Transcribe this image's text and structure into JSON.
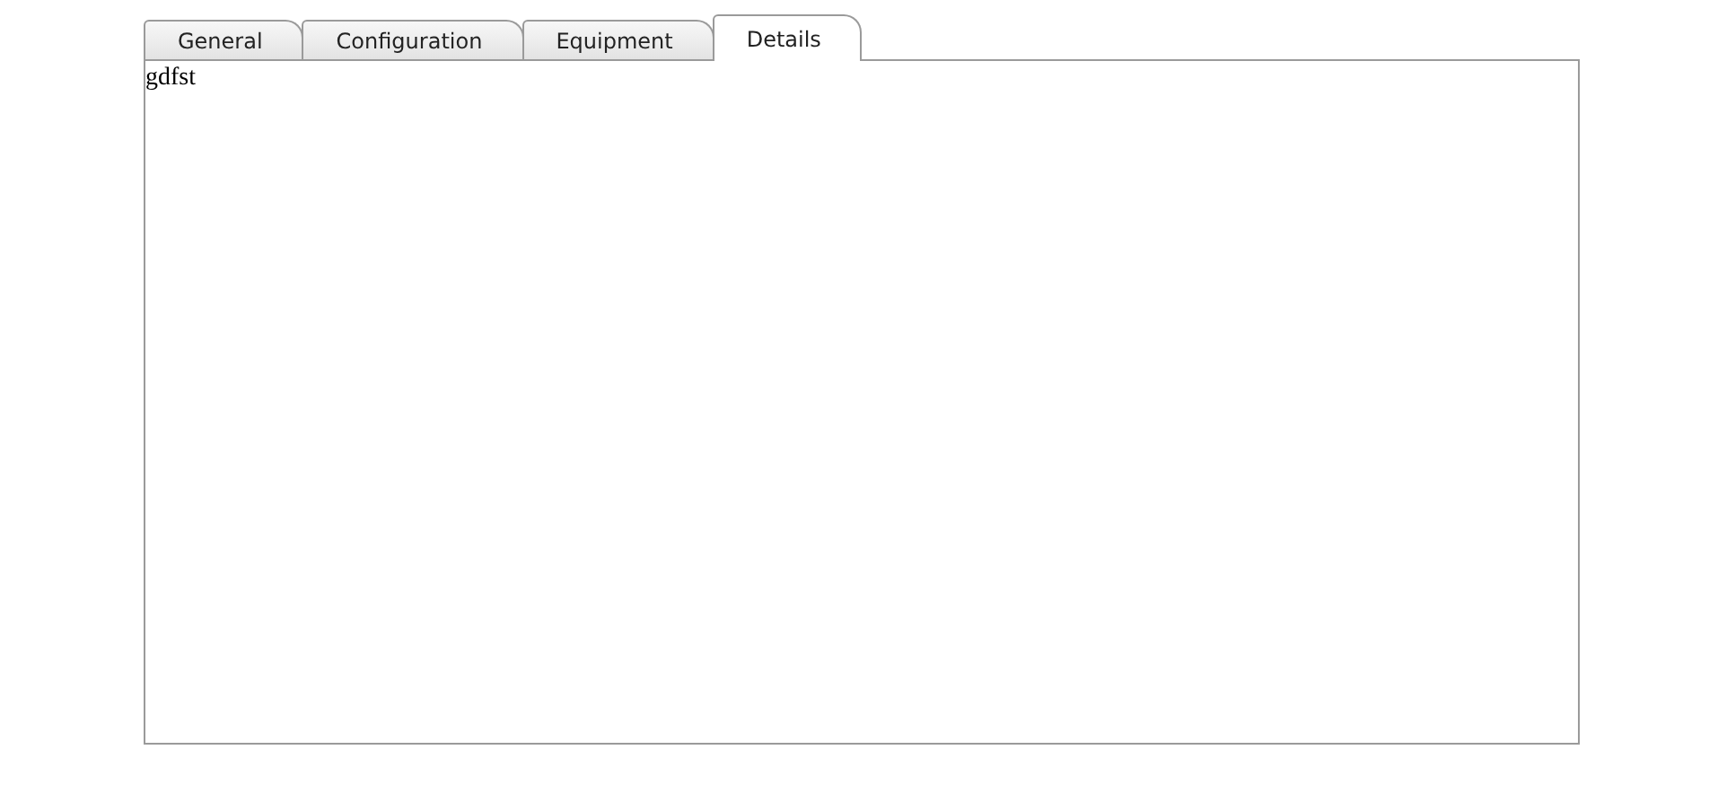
{
  "tabs": [
    {
      "label": "General",
      "selected": false
    },
    {
      "label": "Configuration",
      "selected": false
    },
    {
      "label": "Equipment",
      "selected": false
    },
    {
      "label": "Details",
      "selected": true
    }
  ],
  "panel": {
    "text": "gdfst"
  }
}
